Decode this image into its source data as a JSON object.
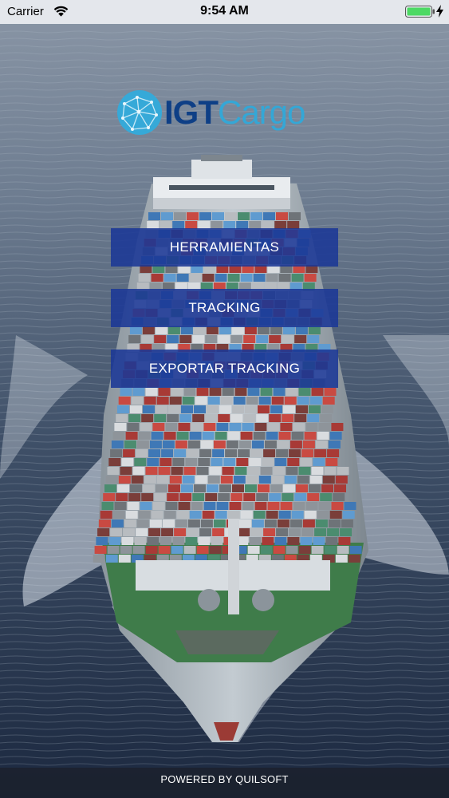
{
  "status_bar": {
    "carrier": "Carrier",
    "time": "9:54 AM",
    "wifi_icon": "wifi-icon",
    "battery_icon": "battery-full-icon",
    "charging_icon": "charging-bolt-icon",
    "battery_color": "#4cd964"
  },
  "logo": {
    "igt": "IGT",
    "cargo": "Cargo",
    "icon": "globe-network-icon",
    "colors": {
      "igt": "#0e3f86",
      "cargo": "#34a7d6"
    }
  },
  "menu": {
    "items": [
      {
        "label": "HERRAMIENTAS"
      },
      {
        "label": "TRACKING"
      },
      {
        "label": "EXPORTAR TRACKING"
      }
    ],
    "button_color": "#1b3896"
  },
  "background": {
    "image": "container-ship-aerial"
  },
  "footer": {
    "text": "POWERED BY QUILSOFT"
  }
}
